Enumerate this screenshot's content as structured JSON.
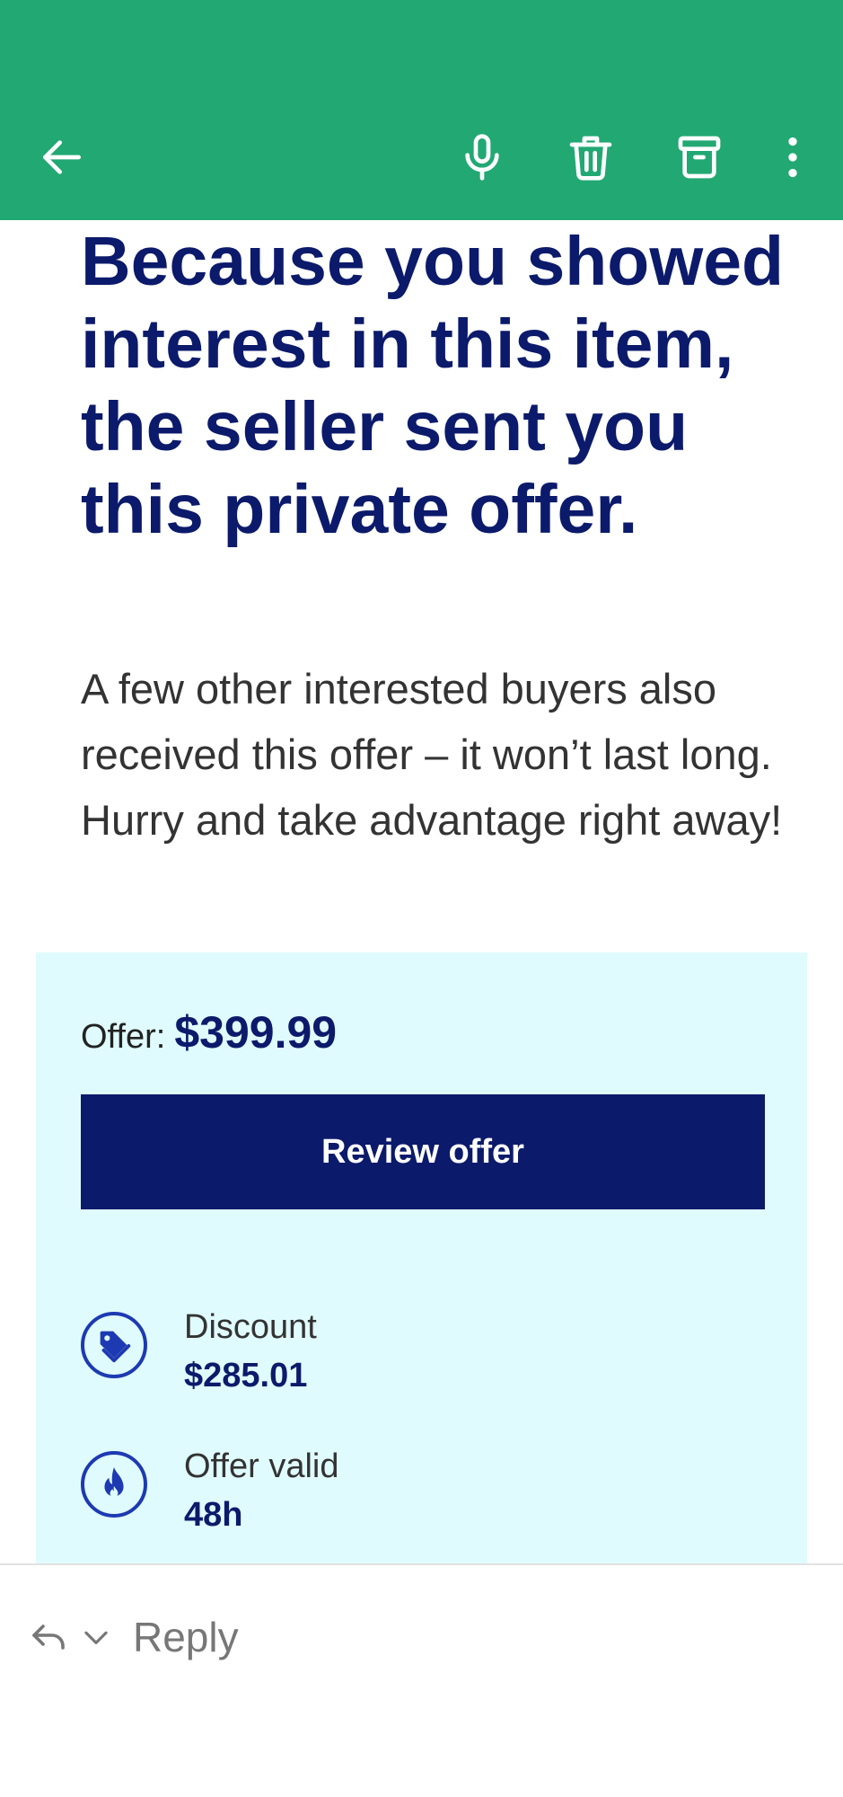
{
  "toolbar": {
    "back_icon": "arrow-back-icon",
    "actions": [
      "mic-icon",
      "trash-icon",
      "archive-icon",
      "more-vert-icon"
    ],
    "background": "#22a873"
  },
  "email": {
    "headline": "Because you showed interest in this item, the seller sent you this private offer.",
    "body": "A few other interested buyers also received this offer – it won’t last long. Hurry and take advantage right away!",
    "offer": {
      "label": "Offer:",
      "price": "$399.99",
      "button_label": "Review offer",
      "details": [
        {
          "icon": "tag-icon",
          "label": "Discount",
          "value": "$285.01"
        },
        {
          "icon": "flame-icon",
          "label": "Offer valid",
          "value": "48h"
        }
      ],
      "card_background": "#e0fbfd",
      "accent": "#0c1a6b"
    }
  },
  "reply": {
    "label": "Reply"
  }
}
